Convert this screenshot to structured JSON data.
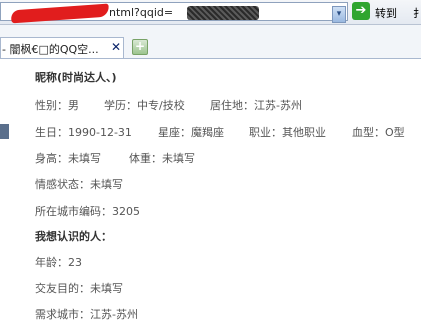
{
  "address_bar": {
    "url_visible": "ntml?qqid=",
    "go_label": "转到",
    "extra_label": "扌"
  },
  "tabs": [
    {
      "label": "- 闇枫€□的QQ空...",
      "active": true
    }
  ],
  "profile": {
    "nickname_heading": "昵称(时尚达人、)",
    "gender": "性别：男",
    "education": "学历：中专/技校",
    "residence": "居住地：江苏-苏州",
    "birthday": "生日：1990-12-31",
    "zodiac": "星座：魔羯座",
    "occupation": "职业：其他职业",
    "blood_type": "血型：O型",
    "height": "身高：未填写",
    "weight": "体重：未填写",
    "relationship": "情感状态：未填写",
    "city_code": "所在城市编码：3205",
    "want_to_meet_heading": "我想认识的人：",
    "age": "年龄：23",
    "purpose": "交友目的：未填写",
    "desired_city": "需求城市：江苏-苏州"
  }
}
